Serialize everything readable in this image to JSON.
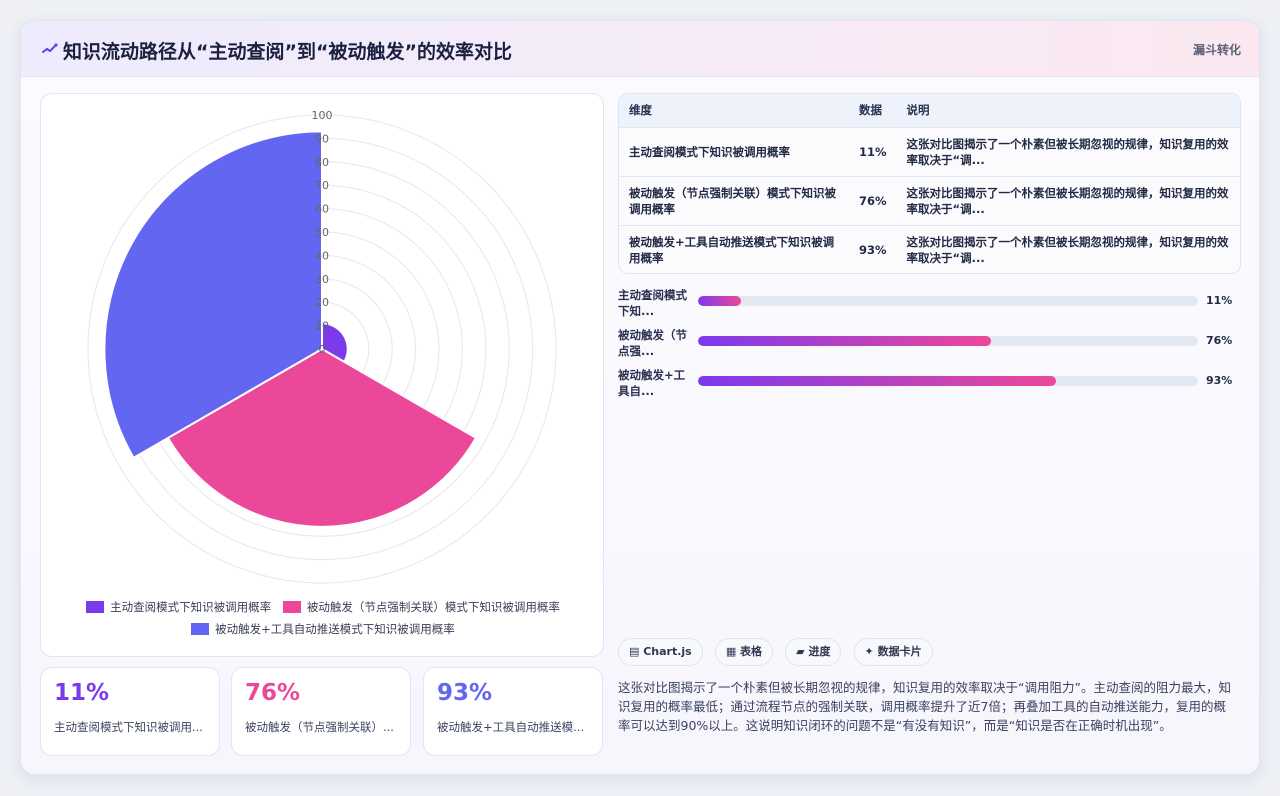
{
  "header": {
    "title": "知识流动路径从“主动查阅”到“被动触发”的效率对比",
    "tag": "漏斗转化",
    "icon": "sparkline-icon"
  },
  "chart_data": {
    "type": "polarArea",
    "categories": [
      "主动查阅模式下知识被调用概率",
      "被动触发（节点强制关联）模式下知识被调用概率",
      "被动触发+工具自动推送模式下知识被调用概率"
    ],
    "values": [
      11,
      76,
      93
    ],
    "colors": [
      "#7c3aed",
      "#ec4899",
      "#6366f1"
    ],
    "r_ticks": [
      "0",
      "10",
      "20",
      "30",
      "40",
      "50",
      "60",
      "70",
      "80",
      "90",
      "100"
    ],
    "rlim": [
      0,
      100
    ],
    "grid": true,
    "legend_position": "bottom"
  },
  "legend": [
    {
      "label": "主动查阅模式下知识被调用概率",
      "color": "#7c3aed"
    },
    {
      "label": "被动触发（节点强制关联）模式下知识被调用概率",
      "color": "#ec4899"
    },
    {
      "label": "被动触发+工具自动推送模式下知识被调用概率",
      "color": "#6366f1"
    }
  ],
  "stats": [
    {
      "value": "11%",
      "label": "主动查阅模式下知识被调用...",
      "color": "#7c3aed"
    },
    {
      "value": "76%",
      "label": "被动触发（节点强制关联）...",
      "color": "#ec4899"
    },
    {
      "value": "93%",
      "label": "被动触发+工具自动推送模...",
      "color": "#6366f1"
    }
  ],
  "table": {
    "headers": [
      "维度",
      "数据",
      "说明"
    ],
    "rows": [
      {
        "dim": "主动查阅模式下知识被调用概率",
        "value": "11%",
        "note": "这张对比图揭示了一个朴素但被长期忽视的规律，知识复用的效率取决于“调..."
      },
      {
        "dim": "被动触发（节点强制关联）模式下知识被调用概率",
        "value": "76%",
        "note": "这张对比图揭示了一个朴素但被长期忽视的规律，知识复用的效率取决于“调..."
      },
      {
        "dim": "被动触发+工具自动推送模式下知识被调用概率",
        "value": "93%",
        "note": "这张对比图揭示了一个朴素但被长期忽视的规律，知识复用的效率取决于“调..."
      }
    ]
  },
  "progress": [
    {
      "label": "主动查阅模式下知...",
      "value_text": "11%",
      "fraction": 0.085
    },
    {
      "label": "被动触发（节点强...",
      "value_text": "76%",
      "fraction": 0.585
    },
    {
      "label": "被动触发+工具自...",
      "value_text": "93%",
      "fraction": 0.715
    }
  ],
  "chips": [
    "▤ Chart.js",
    "▦ 表格",
    "▰ 进度",
    "✦ 数据卡片"
  ],
  "description": "这张对比图揭示了一个朴素但被长期忽视的规律，知识复用的效率取决于“调用阻力”。主动查阅的阻力最大，知识复用的概率最低；通过流程节点的强制关联，调用概率提升了近7倍；再叠加工具的自动推送能力，复用的概率可以达到90%以上。这说明知识闭环的问题不是“有没有知识”，而是“知识是否在正确时机出现”。"
}
